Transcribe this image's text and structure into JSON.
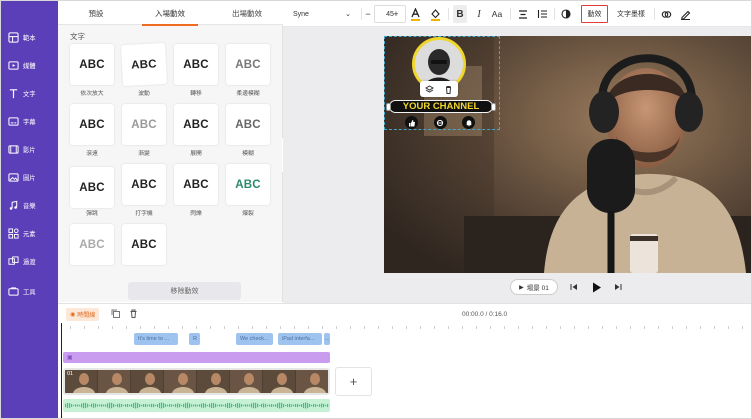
{
  "sidebar": {
    "items": [
      {
        "label": "範本",
        "icon": "template-icon"
      },
      {
        "label": "媒體",
        "icon": "media-icon"
      },
      {
        "label": "文字",
        "icon": "text-icon"
      },
      {
        "label": "字幕",
        "icon": "subtitle-icon"
      },
      {
        "label": "影片",
        "icon": "video-icon"
      },
      {
        "label": "圖片",
        "icon": "image-icon"
      },
      {
        "label": "音樂",
        "icon": "music-icon"
      },
      {
        "label": "元素",
        "icon": "elements-icon"
      },
      {
        "label": "過渡",
        "icon": "transition-icon"
      },
      {
        "label": "工具",
        "icon": "tools-icon"
      }
    ]
  },
  "panel": {
    "tabs": [
      "預設",
      "入場動效",
      "出場動效"
    ],
    "section_title": "文字",
    "animations": [
      {
        "preview": "ABC",
        "label": "依次放大"
      },
      {
        "preview": "ABC",
        "label": "波動"
      },
      {
        "preview": "ABC",
        "label": "轉移"
      },
      {
        "preview": "ABC",
        "label": "柔邊模糊"
      },
      {
        "preview": "ABC",
        "label": "滾遠"
      },
      {
        "preview": "ABC",
        "label": "漸變"
      },
      {
        "preview": "ABC",
        "label": "展開"
      },
      {
        "preview": "ABC",
        "label": "模糊"
      },
      {
        "preview": "ABC",
        "label": "彈跳"
      },
      {
        "preview": "ABC",
        "label": "打字機"
      },
      {
        "preview": "ABC",
        "label": "閃爍"
      },
      {
        "preview": "ABC",
        "label": "爆裂"
      },
      {
        "preview": "ABC",
        "label": ""
      },
      {
        "preview": "ABC",
        "label": ""
      }
    ],
    "remove_label": "移除動效"
  },
  "toolbar": {
    "font": "Syne",
    "font_size": "45",
    "decrease": "−",
    "increase": "+",
    "text_case": "Aa",
    "animation_label": "動效",
    "text_style_label": "文字墨樣"
  },
  "canvas": {
    "overlay_text": "YOUR CHANNEL",
    "colors": {
      "accent": "#ef6b1e",
      "brand": "#5b3fb9",
      "overlay_yellow": "#f0d62c",
      "selection": "#e23b3b"
    }
  },
  "player": {
    "scene_label": "場景 01"
  },
  "timeline": {
    "label": "時間線",
    "timecode": "00:00.0 / 0:16.0",
    "text_clips": [
      "It's time to ...",
      "R",
      "We check...",
      "iPad interfa...",
      "..."
    ],
    "video_clip_label": "01",
    "add_label": "+"
  }
}
